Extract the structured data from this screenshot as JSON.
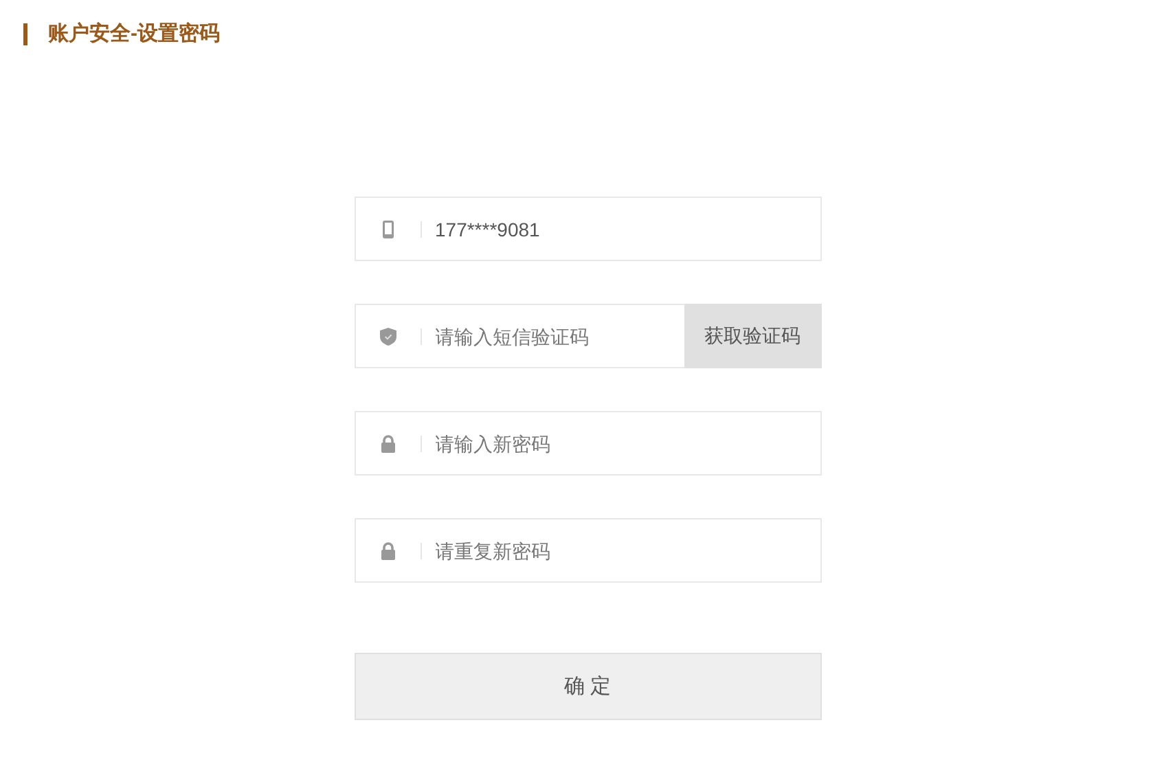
{
  "title": "账户安全-设置密码",
  "fields": [
    {
      "kind": "phone",
      "value": "177****9081"
    },
    {
      "kind": "shield",
      "placeholder": "请输入短信验证码",
      "button": "获取验证码"
    },
    {
      "kind": "lock",
      "placeholder": "请输入新密码"
    },
    {
      "kind": "lock",
      "placeholder": "请重复新密码"
    }
  ],
  "submit": "确 定"
}
